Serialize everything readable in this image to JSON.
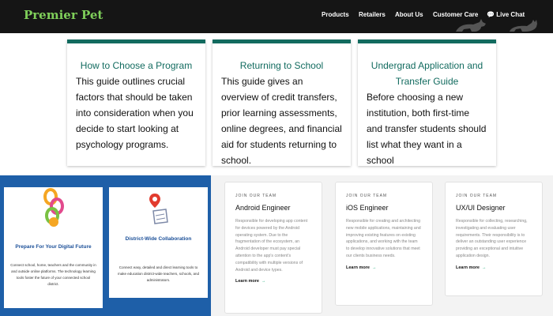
{
  "header": {
    "brand": "Premier Pet",
    "nav": [
      {
        "label": "Products"
      },
      {
        "label": "Retailers"
      },
      {
        "label": "About Us"
      },
      {
        "label": "Customer Care"
      },
      {
        "label": "Live Chat"
      }
    ]
  },
  "guides": [
    {
      "title": "How to Choose a Program",
      "description": "This guide outlines crucial factors that should be taken into consideration when you decide to start looking at psychology programs."
    },
    {
      "title": "Returning to School",
      "description": "This guide gives an overview of credit transfers, prior learning assessments, online degrees, and financial aid for students returning to school."
    },
    {
      "title": "Undergrad Application and Transfer Guide",
      "description": "Before choosing a new institution, both first-time and transfer students should list what they want in a school"
    }
  ],
  "features": [
    {
      "title": "Prepare For Your Digital Future",
      "description": "Connect school, home, teachers and the community in and outside online platforms. The technology learning tools foster the future of your connected school district."
    },
    {
      "title": "District-Wide Collaboration",
      "description": "Connect easy, detailed and direct learning tools to make education district-wide teachers, schools, and administrators."
    }
  ],
  "jobs": [
    {
      "tag": "JOIN OUR TEAM",
      "title": "Android Engineer",
      "description": "Responsible for developing app content for devices powered by the Android operating system. Due to the fragmentation of the ecosystem, an Android developer must pay special attention to the app's content's compatibility with multiple versions of Android and device types.",
      "link": "Learn more"
    },
    {
      "tag": "JOIN OUR TEAM",
      "title": "iOS Engineer",
      "description": "Responsible for creating and architecting new mobile applications, maintaining and improving existing features on existing applications, and working with the team to develop innovative solutions that meet our clients business needs.",
      "link": "Learn more"
    },
    {
      "tag": "JOIN OUR TEAM",
      "title": "UX/UI Designer",
      "description": "Responsible for collecting, researching, investigating and evaluating user requirements. Their responsibility is to deliver an outstanding user experience providing an exceptional and intuitive application design.",
      "link": "Learn more"
    }
  ],
  "colors": {
    "header_bg": "#151515",
    "brand": "#7fcf5a",
    "guide_accent": "#126b5f",
    "feature_panel": "#1e5fa8",
    "job_link_arrow": "#19a974"
  }
}
